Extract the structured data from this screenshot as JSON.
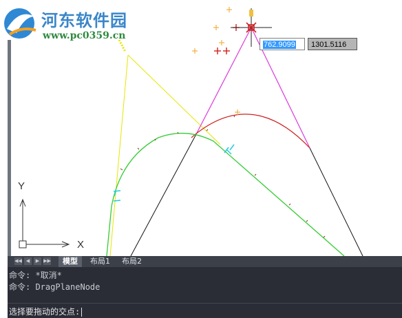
{
  "watermark": {
    "title": "河东软件园",
    "url": "www.pc0359.cn"
  },
  "dynamic_input": {
    "x_value": "762.9099",
    "y_value": "1301.5116"
  },
  "ucs": {
    "x_label": "X",
    "y_label": "Y"
  },
  "tabs": {
    "nav": [
      "◀◀",
      "◀",
      "▶",
      "▶▶"
    ],
    "items": [
      {
        "label": "模型",
        "active": true
      },
      {
        "label": "布局1",
        "active": false
      },
      {
        "label": "布局2",
        "active": false
      }
    ]
  },
  "command": {
    "history": [
      "命令: *取消*",
      "命令: DragPlaneNode"
    ],
    "prompt": "选择要拖动的交点:"
  },
  "colors": {
    "canvas": "#ffffff",
    "green_curve": "#33cc33",
    "red_arc": "#cc2222",
    "yellow_line": "#e6e600",
    "magenta_line": "#dd44dd",
    "black_line": "#111111",
    "command_bg": "#2a2d35"
  }
}
